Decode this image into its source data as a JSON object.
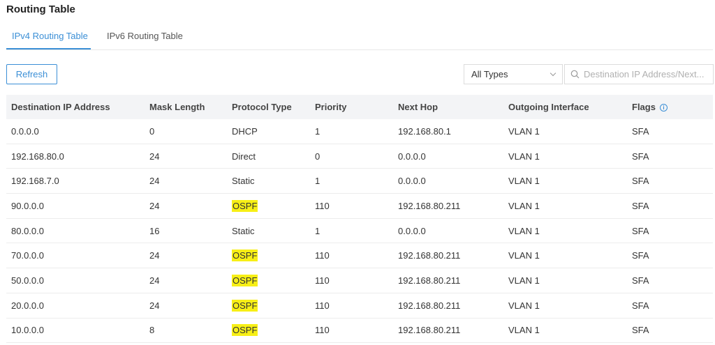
{
  "page": {
    "title": "Routing Table"
  },
  "tabs": [
    {
      "label": "IPv4 Routing Table",
      "active": true
    },
    {
      "label": "IPv6 Routing Table",
      "active": false
    }
  ],
  "toolbar": {
    "refresh_label": "Refresh",
    "type_filter": {
      "selected": "All Types"
    },
    "search": {
      "placeholder": "Destination IP Address/Next..."
    }
  },
  "colors": {
    "accent": "#3b8fd6",
    "highlight": "#f7ef16",
    "header_bg": "#f3f4f6"
  },
  "table": {
    "columns": [
      "Destination IP Address",
      "Mask Length",
      "Protocol Type",
      "Priority",
      "Next Hop",
      "Outgoing Interface",
      "Flags"
    ],
    "rows": [
      {
        "dest": "0.0.0.0",
        "mask": "0",
        "protocol": "DHCP",
        "priority": "1",
        "next_hop": "192.168.80.1",
        "iface": "VLAN 1",
        "flags": "SFA",
        "highlight": false
      },
      {
        "dest": "192.168.80.0",
        "mask": "24",
        "protocol": "Direct",
        "priority": "0",
        "next_hop": "0.0.0.0",
        "iface": "VLAN 1",
        "flags": "SFA",
        "highlight": false
      },
      {
        "dest": "192.168.7.0",
        "mask": "24",
        "protocol": "Static",
        "priority": "1",
        "next_hop": "0.0.0.0",
        "iface": "VLAN 1",
        "flags": "SFA",
        "highlight": false
      },
      {
        "dest": "90.0.0.0",
        "mask": "24",
        "protocol": "OSPF",
        "priority": "110",
        "next_hop": "192.168.80.211",
        "iface": "VLAN 1",
        "flags": "SFA",
        "highlight": true
      },
      {
        "dest": "80.0.0.0",
        "mask": "16",
        "protocol": "Static",
        "priority": "1",
        "next_hop": "0.0.0.0",
        "iface": "VLAN 1",
        "flags": "SFA",
        "highlight": false
      },
      {
        "dest": "70.0.0.0",
        "mask": "24",
        "protocol": "OSPF",
        "priority": "110",
        "next_hop": "192.168.80.211",
        "iface": "VLAN 1",
        "flags": "SFA",
        "highlight": true
      },
      {
        "dest": "50.0.0.0",
        "mask": "24",
        "protocol": "OSPF",
        "priority": "110",
        "next_hop": "192.168.80.211",
        "iface": "VLAN 1",
        "flags": "SFA",
        "highlight": true
      },
      {
        "dest": "20.0.0.0",
        "mask": "24",
        "protocol": "OSPF",
        "priority": "110",
        "next_hop": "192.168.80.211",
        "iface": "VLAN 1",
        "flags": "SFA",
        "highlight": true
      },
      {
        "dest": "10.0.0.0",
        "mask": "8",
        "protocol": "OSPF",
        "priority": "110",
        "next_hop": "192.168.80.211",
        "iface": "VLAN 1",
        "flags": "SFA",
        "highlight": true
      }
    ]
  }
}
